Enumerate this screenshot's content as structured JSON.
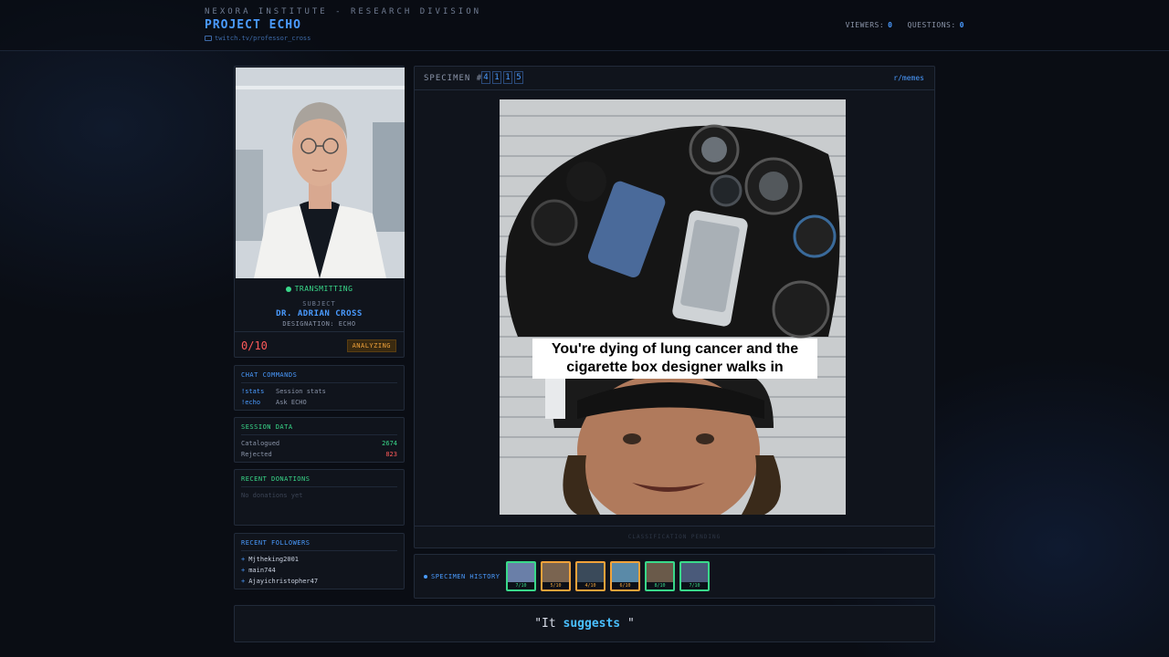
{
  "header": {
    "org": "NEXORA INSTITUTE - RESEARCH DIVISION",
    "project": "PROJECT ECHO",
    "channel": "twitch.tv/professor_cross",
    "viewers_label": "VIEWERS:",
    "viewers": "0",
    "questions_label": "QUESTIONS:",
    "questions": "0"
  },
  "profile": {
    "status": "TRANSMITTING",
    "subject_label": "SUBJECT",
    "name": "DR. ADRIAN CROSS",
    "designation": "DESIGNATION: ECHO",
    "score": "0/10",
    "state": "ANALYZING"
  },
  "commands": {
    "title": "CHAT COMMANDS",
    "items": [
      {
        "cmd": "!stats",
        "desc": "Session stats"
      },
      {
        "cmd": "!echo",
        "desc": "Ask ECHO"
      }
    ]
  },
  "session": {
    "title": "SESSION DATA",
    "catalogued_label": "Catalogued",
    "catalogued": "2674",
    "rejected_label": "Rejected",
    "rejected": "823"
  },
  "donations": {
    "title": "RECENT DONATIONS",
    "empty": "No donations yet"
  },
  "followers": {
    "title": "RECENT FOLLOWERS",
    "items": [
      "Mjtheking2001",
      "main744",
      "Ajayichristopher47"
    ]
  },
  "specimen": {
    "label": "SPECIMEN #",
    "digits": [
      "4",
      "1",
      "1",
      "5"
    ],
    "subreddit": "r/memes",
    "caption_line1": "You're dying of lung cancer and the",
    "caption_line2": "cigarette box designer walks in",
    "footer": "CLASSIFICATION PENDING"
  },
  "history": {
    "label": "SPECIMEN HISTORY",
    "items": [
      {
        "score": "7/10",
        "tone": "green",
        "color": "#6a7fa8"
      },
      {
        "score": "5/10",
        "tone": "orange",
        "color": "#7a6450"
      },
      {
        "score": "4/10",
        "tone": "orange",
        "color": "#3a4a5a"
      },
      {
        "score": "6/10",
        "tone": "orange",
        "color": "#5a8aa8"
      },
      {
        "score": "8/10",
        "tone": "green",
        "color": "#6a5a4a"
      },
      {
        "score": "7/10",
        "tone": "green",
        "color": "#4a5a7a"
      }
    ]
  },
  "quote": {
    "open": "\"It ",
    "highlight": "suggests",
    "close": " \""
  },
  "colors": {
    "accent": "#4a9bff",
    "green": "#39d98a",
    "red": "#ff5a5a",
    "orange": "#f0a23a"
  }
}
